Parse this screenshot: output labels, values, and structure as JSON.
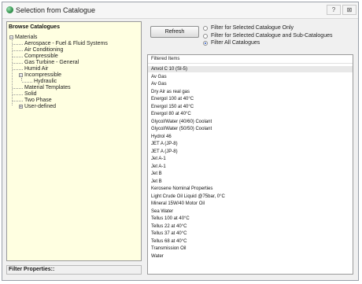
{
  "window": {
    "title": "Selection from Catalogue",
    "help_label": "?",
    "close_label": "⊠"
  },
  "left_panel": {
    "header": "Browse Catalogues",
    "tree": [
      {
        "label": "Materials",
        "expander": "−"
      },
      {
        "label": "Aerospace - Fuel & Fluid Systems"
      },
      {
        "label": "Air Conditioning"
      },
      {
        "label": "Compressible"
      },
      {
        "label": "Gas Turbine - General"
      },
      {
        "label": "Humid Air"
      },
      {
        "label": "Incompressible",
        "expander": "−"
      },
      {
        "label": "Hydraulic"
      },
      {
        "label": "Material Templates"
      },
      {
        "label": "Solid"
      },
      {
        "label": "Two Phase"
      },
      {
        "label": "User-defined",
        "expander": "+"
      }
    ]
  },
  "filter_properties": "Filter Properties::",
  "refresh_label": "Refresh",
  "filters": [
    {
      "label": "Filter for Selected Catalogue Only",
      "checked": false
    },
    {
      "label": "Filter for Selected Catalogue and Sub-Catalogues",
      "checked": false
    },
    {
      "label": "Filter All Catalogues",
      "checked": true
    }
  ],
  "list": {
    "header": "Filtered Items",
    "selected_item": "Anvol C 10 (SI-5)",
    "items": [
      "Anvol C 10 (SI-5)",
      "Av Gas",
      "Av Gas",
      "Dry Air as real gas",
      "Energol 100 at 40°C",
      "Energol 150 at 40°C",
      "Energol 80 at 40°C",
      "Glycol/Water (40/60) Coolant",
      "Glycol/Water (50/50) Coolant",
      "Hydrol 46",
      "JET A (JP-8)",
      "JET A (JP-8)",
      "Jet A-1",
      "Jet A-1",
      "Jet B",
      "Jet B",
      "Kerosene Nominal Properties",
      "Light Crude Oil Liquid @75bar, 0°C",
      "Mineral 15W/40 Motor Oil",
      "Sea Water",
      "Tellus 100 at 40°C",
      "Tellus 22 at 40°C",
      "Tellus 37 at 40°C",
      "Tellus 68 at 40°C",
      "Transmission Oil",
      "Water"
    ]
  }
}
